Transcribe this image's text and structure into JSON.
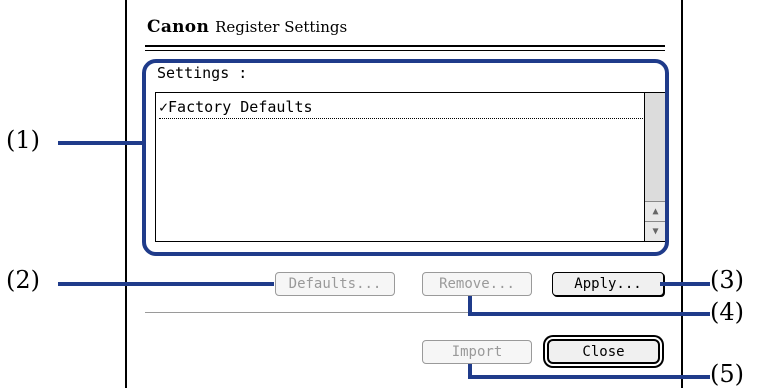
{
  "dialog": {
    "brand": "Canon",
    "title": "Register Settings",
    "settings_label": "Settings :",
    "list_items": [
      {
        "label": "✓Factory Defaults"
      }
    ],
    "buttons": {
      "defaults": "Defaults...",
      "remove": "Remove...",
      "apply": "Apply...",
      "import": "Import",
      "close": "Close"
    }
  },
  "callouts": {
    "c1": "(1)",
    "c2": "(2)",
    "c3": "(3)",
    "c4": "(4)",
    "c5": "(5)"
  },
  "colors": {
    "callout": "#1f3b8a"
  }
}
